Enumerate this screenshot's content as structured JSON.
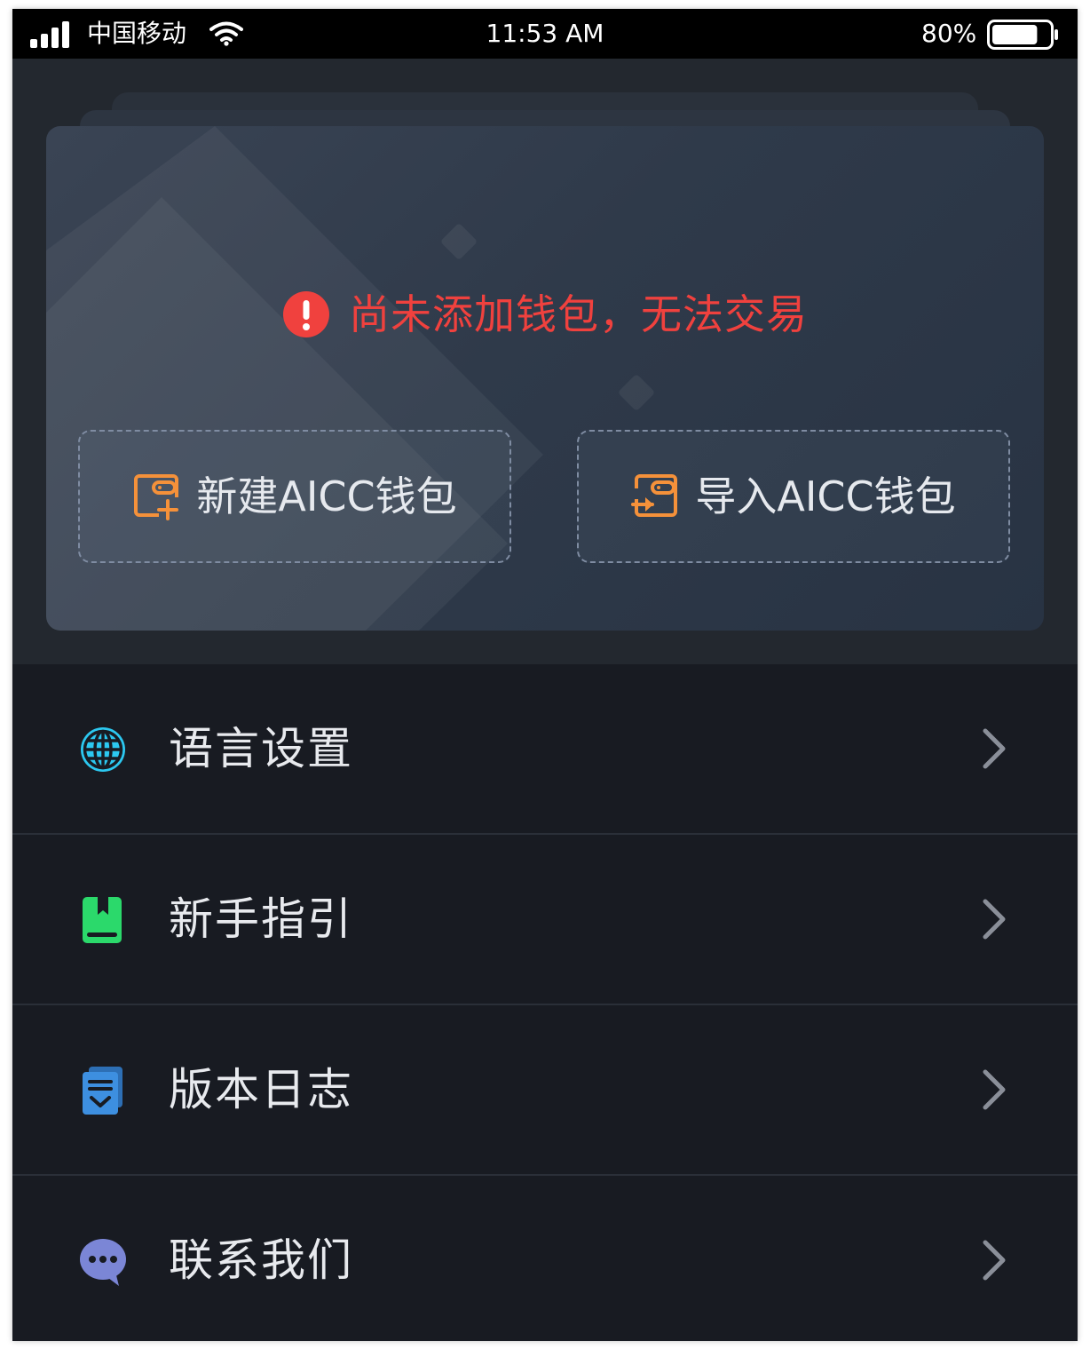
{
  "status_bar": {
    "carrier": "中国移动",
    "time": "11:53 AM",
    "battery_percent": "80%",
    "battery_level": 0.8,
    "icons": [
      "signal-icon",
      "wifi-icon",
      "battery-icon"
    ]
  },
  "wallet_card": {
    "warning_text": "尚未添加钱包，无法交易",
    "warning_icon": "exclamation-circle-icon",
    "create_label": "新建AICC钱包",
    "create_icon": "wallet-add-icon",
    "import_label": "导入AICC钱包",
    "import_icon": "wallet-import-icon"
  },
  "menu": {
    "items": [
      {
        "label": "语言设置",
        "icon": "globe-icon",
        "icon_color": "#2cc8f0"
      },
      {
        "label": "新手指引",
        "icon": "book-icon",
        "icon_color": "#2bd96b"
      },
      {
        "label": "版本日志",
        "icon": "log-icon",
        "icon_color": "#3d8fe0"
      },
      {
        "label": "联系我们",
        "icon": "chat-icon",
        "icon_color": "#7b86d6"
      }
    ]
  },
  "colors": {
    "background": "#181b22",
    "card_accent_warning": "#f0413e",
    "button_icon_orange": "#f5913a",
    "chevron": "#8a8f99"
  }
}
